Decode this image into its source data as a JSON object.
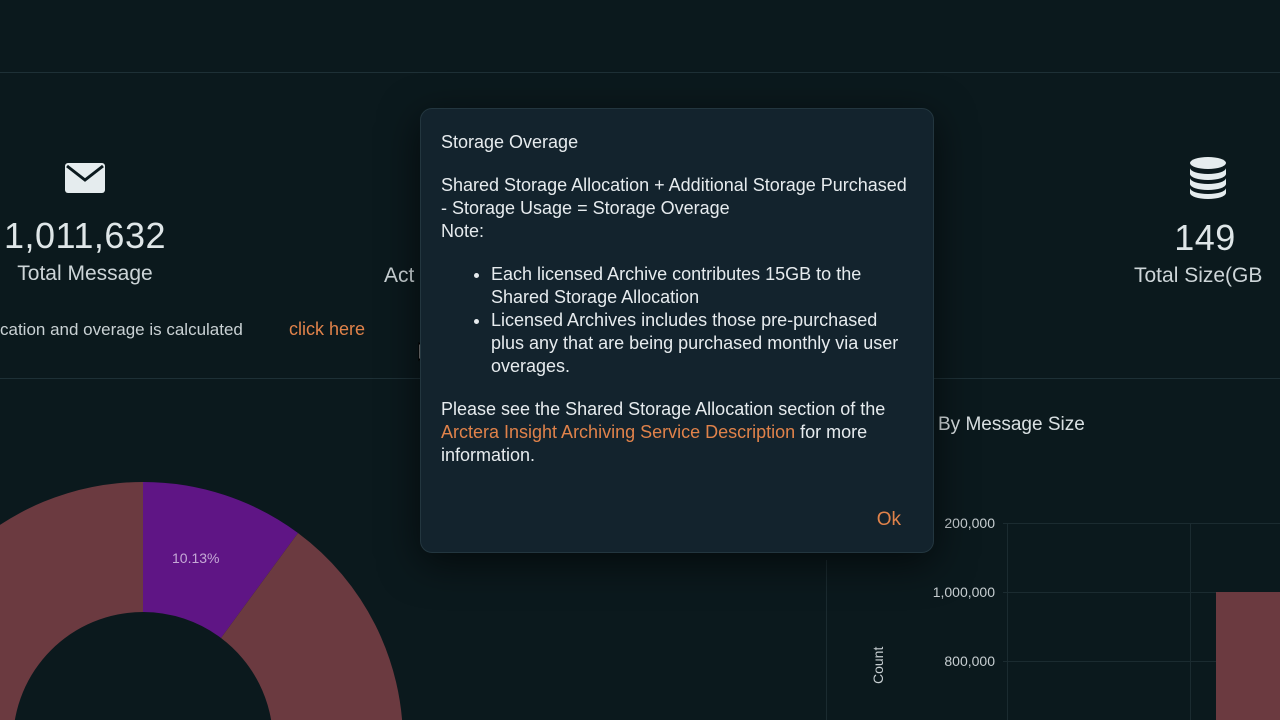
{
  "stats": {
    "total_message": {
      "value": "1,011,632",
      "label": "Total Message",
      "icon": "envelope-icon"
    },
    "active": {
      "label_partial": "Act"
    },
    "total_size": {
      "value": "149",
      "label": "Total Size(GB",
      "icon": "database-icon"
    }
  },
  "info_line": {
    "text": "cation and overage is calculated",
    "link": "click here"
  },
  "donut": {
    "slice_label": "10.13%",
    "colors": {
      "main": "#6b3a40",
      "purple": "#5f1585"
    }
  },
  "bar_chart": {
    "title_partial": "By Message Size",
    "ylabel": "Count",
    "yticks": [
      "200,000",
      "1,000,000",
      "800,000"
    ],
    "bar_color": "#6b3a40"
  },
  "modal": {
    "title": "Storage Overage",
    "formula": "Shared Storage Allocation + Additional Storage Purchased - Storage Usage = Storage Overage",
    "note": "Note:",
    "bullets": [
      "Each licensed Archive contributes 15GB to the Shared Storage Allocation",
      "Licensed Archives includes those pre-purchased plus any that are being purchased monthly via user overages."
    ],
    "footer_prefix": "Please see the Shared Storage Allocation section of the ",
    "footer_link": "Arctera Insight Archiving Service Description",
    "footer_suffix": " for more information.",
    "ok_label": "Ok"
  },
  "colors": {
    "background": "#0b191d",
    "modal_bg": "#13232d",
    "accent": "#e0824a"
  }
}
